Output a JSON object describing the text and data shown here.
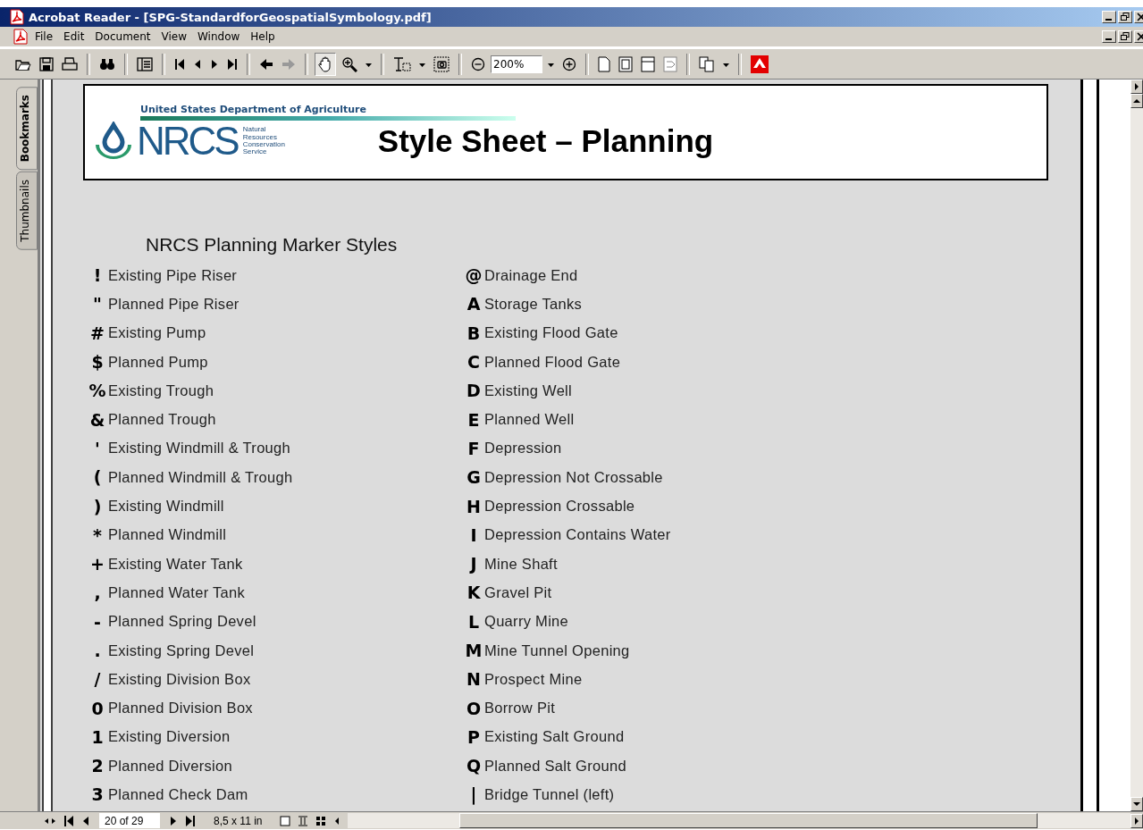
{
  "window": {
    "title": "Acrobat Reader - [SPG-StandardforGeospatialSymbology.pdf]"
  },
  "menu": [
    "File",
    "Edit",
    "Document",
    "View",
    "Window",
    "Help"
  ],
  "toolbar": {
    "hand_tool_pressed": true,
    "zoom_value": "200%"
  },
  "side_tabs": [
    {
      "label": "Bookmarks",
      "selected": true
    },
    {
      "label": "Thumbnails",
      "selected": false
    }
  ],
  "page": {
    "logo": {
      "agency": "United States Department of Agriculture",
      "acronym": "NRCS",
      "full_name": [
        "Natural",
        "Resources",
        "Conservation",
        "Service"
      ]
    },
    "title": "Style Sheet – Planning",
    "heading": "NRCS Planning Marker Styles",
    "columns": [
      [
        {
          "symbol": "!",
          "label": "Existing Pipe Riser"
        },
        {
          "symbol": "\"",
          "label": "Planned Pipe Riser"
        },
        {
          "symbol": "#",
          "label": "Existing Pump"
        },
        {
          "symbol": "$",
          "label": "Planned Pump"
        },
        {
          "symbol": "%",
          "label": "Existing Trough"
        },
        {
          "symbol": "&",
          "label": "Planned Trough"
        },
        {
          "symbol": "'",
          "label": "Existing Windmill & Trough"
        },
        {
          "symbol": "(",
          "label": "Planned Windmill & Trough"
        },
        {
          "symbol": ")",
          "label": "Existing Windmill"
        },
        {
          "symbol": "*",
          "label": "Planned Windmill"
        },
        {
          "symbol": "+",
          "label": "Existing Water Tank"
        },
        {
          "symbol": ",",
          "label": "Planned Water Tank"
        },
        {
          "symbol": "-",
          "label": "Planned Spring Devel"
        },
        {
          "symbol": ".",
          "label": "Existing Spring Devel"
        },
        {
          "symbol": "/",
          "label": "Existing Division Box"
        },
        {
          "symbol": "0",
          "label": "Planned Division Box"
        },
        {
          "symbol": "1",
          "label": "Existing Diversion"
        },
        {
          "symbol": "2",
          "label": "Planned Diversion"
        },
        {
          "symbol": "3",
          "label": "Planned Check Dam"
        }
      ],
      [
        {
          "symbol": "@",
          "label": "Drainage End"
        },
        {
          "symbol": "A",
          "label": "Storage Tanks"
        },
        {
          "symbol": "B",
          "label": "Existing Flood Gate"
        },
        {
          "symbol": "C",
          "label": "Planned Flood Gate"
        },
        {
          "symbol": "D",
          "label": "Existing Well"
        },
        {
          "symbol": "E",
          "label": "Planned Well"
        },
        {
          "symbol": "F",
          "label": "Depression"
        },
        {
          "symbol": "G",
          "label": "Depression Not Crossable"
        },
        {
          "symbol": "H",
          "label": "Depression Crossable"
        },
        {
          "symbol": "I",
          "label": "Depression Contains Water"
        },
        {
          "symbol": "J",
          "label": "Mine Shaft"
        },
        {
          "symbol": "K",
          "label": "Gravel Pit"
        },
        {
          "symbol": "L",
          "label": "Quarry Mine"
        },
        {
          "symbol": "M",
          "label": "Mine Tunnel Opening"
        },
        {
          "symbol": "N",
          "label": "Prospect Mine"
        },
        {
          "symbol": "O",
          "label": "Borrow Pit"
        },
        {
          "symbol": "P",
          "label": "Existing Salt Ground"
        },
        {
          "symbol": "Q",
          "label": "Planned Salt Ground"
        },
        {
          "symbol": "|",
          "label": "Bridge Tunnel (left)"
        }
      ]
    ]
  },
  "status_bar": {
    "page_field": "20 of 29",
    "page_size": "8,5 x 11 in"
  }
}
